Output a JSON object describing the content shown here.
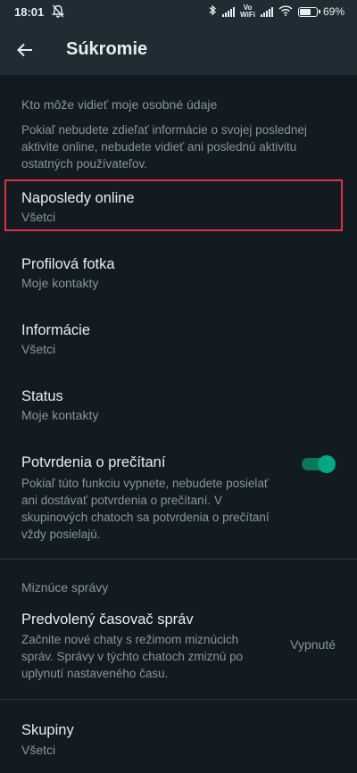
{
  "status_bar": {
    "time": "18:01",
    "battery": "69%",
    "battery_level": 0.69,
    "vowifi_top": "Vo",
    "vowifi_bottom": "WiFi"
  },
  "app_bar": {
    "title": "Súkromie"
  },
  "personal_info": {
    "header": "Kto môže vidieť moje osobné údaje",
    "description": "Pokiaľ nebudete zdieľať informácie o svojej poslednej aktivite online, nebudete vidieť ani poslednú aktivitu ostatných používateľov."
  },
  "items": {
    "last_seen": {
      "title": "Naposledy online",
      "value": "Všetci"
    },
    "profile_photo": {
      "title": "Profilová fotka",
      "value": "Moje kontakty"
    },
    "about": {
      "title": "Informácie",
      "value": "Všetci"
    },
    "status": {
      "title": "Status",
      "value": "Moje kontakty"
    },
    "read_receipts": {
      "title": "Potvrdenia o prečítaní",
      "description": "Pokiaľ túto funkciu vypnete, nebudete posielať ani dostávať potvrdenia o prečítaní. V skupinových chatoch sa potvrdenia o prečítaní vždy posielajú.",
      "enabled": true
    }
  },
  "disappearing": {
    "header": "Miznúce správy",
    "default_timer": {
      "title": "Predvolený časovač správ",
      "description": "Začnite nové chaty s režimom miznúcich správ. Správy v týchto chatoch zmiznú po uplynutí nastaveného času.",
      "value": "Vypnuté"
    }
  },
  "groups": {
    "title": "Skupiny",
    "value": "Všetci"
  },
  "colors": {
    "background": "#121b22",
    "accent": "#00a884",
    "highlight_box": "#e0313a"
  }
}
